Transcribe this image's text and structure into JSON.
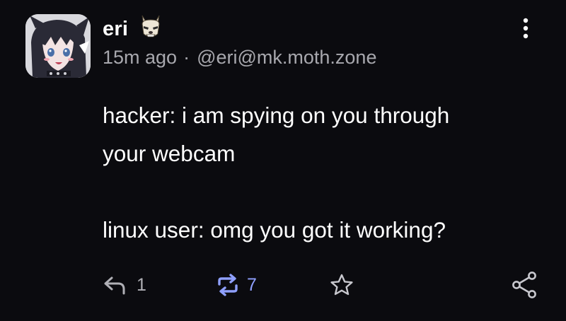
{
  "post": {
    "author_name": "eri",
    "time_ago": "15m ago",
    "separator": "·",
    "handle": "@eri@mk.moth.zone",
    "text_lines": [
      "hacker: i am spying on you through",
      "your webcam",
      "",
      "linux user: omg you got it working?"
    ]
  },
  "actions": {
    "reply_icon": "reply-icon",
    "reply_count": "1",
    "renote_icon": "renote-icon",
    "renote_count": "7",
    "react_icon": "star-icon",
    "share_icon": "share-icon",
    "more_icon": "more-vertical-icon"
  },
  "colors": {
    "background": "#0b0b0f",
    "text": "#ffffff",
    "muted": "#a8a8ae",
    "renote_accent": "#8fa0ff"
  }
}
